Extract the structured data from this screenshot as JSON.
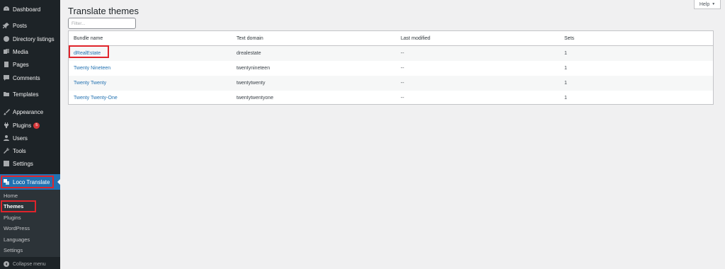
{
  "sidebar": {
    "items": [
      {
        "label": "Dashboard",
        "icon": "dashboard-icon"
      },
      {
        "label": "Posts",
        "icon": "pin-icon"
      },
      {
        "label": "Directory listings",
        "icon": "globe-icon"
      },
      {
        "label": "Media",
        "icon": "media-icon"
      },
      {
        "label": "Pages",
        "icon": "pages-icon"
      },
      {
        "label": "Comments",
        "icon": "comment-icon"
      },
      {
        "label": "Templates",
        "icon": "folder-icon"
      },
      {
        "label": "Appearance",
        "icon": "brush-icon"
      },
      {
        "label": "Plugins",
        "icon": "plugin-icon",
        "badge": "5"
      },
      {
        "label": "Users",
        "icon": "user-icon"
      },
      {
        "label": "Tools",
        "icon": "wrench-icon"
      },
      {
        "label": "Settings",
        "icon": "settings-icon"
      }
    ],
    "active": {
      "label": "Loco Translate",
      "icon": "translate-icon"
    },
    "submenu": [
      "Home",
      "Themes",
      "Plugins",
      "WordPress",
      "Languages",
      "Settings"
    ],
    "submenu_current": "Themes",
    "collapse_label": "Collapse menu"
  },
  "header": {
    "title": "Translate themes",
    "help_label": "Help"
  },
  "filter": {
    "placeholder": "Filter..."
  },
  "table": {
    "columns": [
      "Bundle name",
      "Text domain",
      "Last modified",
      "Sets"
    ],
    "rows": [
      {
        "bundle": "dRealEstate",
        "domain": "drealestate",
        "modified": "--",
        "sets": "1"
      },
      {
        "bundle": "Twenty Nineteen",
        "domain": "twentynineteen",
        "modified": "--",
        "sets": "1"
      },
      {
        "bundle": "Twenty Twenty",
        "domain": "twentytwenty",
        "modified": "--",
        "sets": "1"
      },
      {
        "bundle": "Twenty Twenty-One",
        "domain": "twentytwentyone",
        "modified": "--",
        "sets": "1"
      }
    ]
  },
  "colors": {
    "sidebar_bg": "#1d2327",
    "active_bg": "#2271b1",
    "highlight": "#e0242b",
    "link": "#2271b1"
  }
}
